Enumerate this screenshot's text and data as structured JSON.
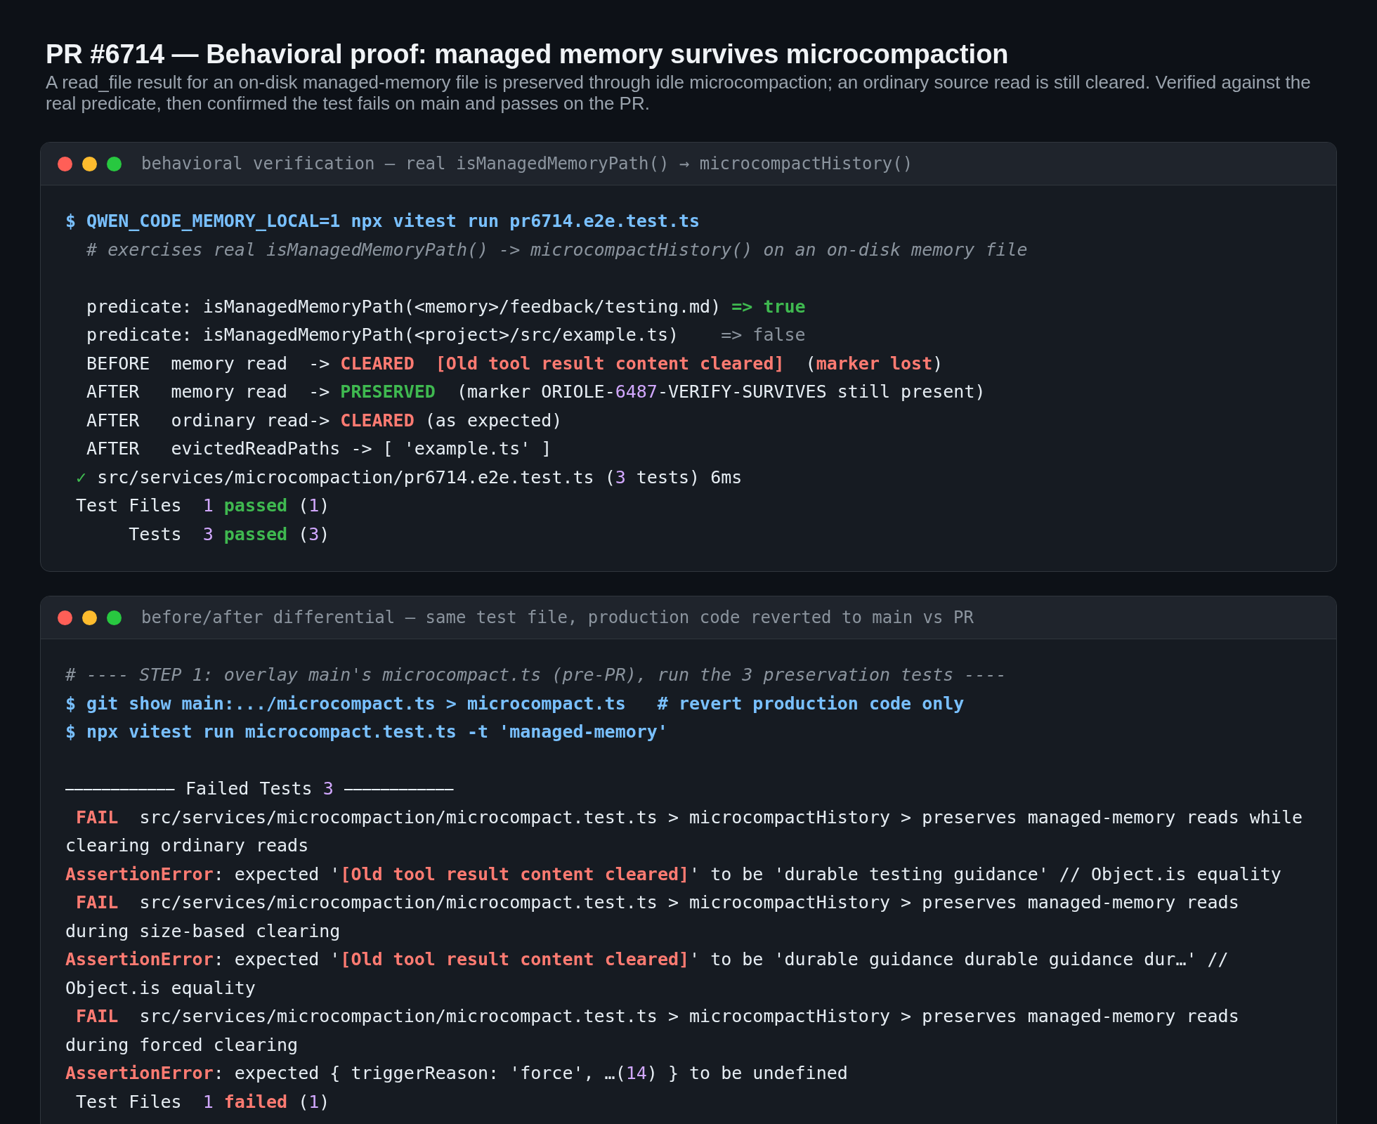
{
  "title": "PR #6714 — Behavioral proof: managed memory survives microcompaction",
  "subtitle": "A read_file result for an on-disk managed-memory file is preserved through idle microcompaction; an ordinary source read is still cleared. Verified against the real predicate, then confirmed the test fails on main and passes on the PR.",
  "terminals": [
    {
      "title": "behavioral verification — real isManagedMemoryPath() → microcompactHistory()",
      "lines": [
        {
          "kind": "text",
          "parts": [
            {
              "kind": "command",
              "text": "$ QWEN_CODE_MEMORY_LOCAL=1 npx vitest run pr6714.e2e.test.ts"
            }
          ]
        },
        {
          "kind": "text",
          "parts": [
            {
              "kind": "comment",
              "text": "  # exercises real isManagedMemoryPath() -> microcompactHistory() on an on-disk memory file"
            }
          ]
        },
        {
          "kind": "blank"
        },
        {
          "kind": "text",
          "parts": [
            {
              "kind": "output",
              "text": "  predicate: isManagedMemoryPath(<memory>/feedback/testing.md) "
            },
            {
              "kind": "success",
              "text": "=> true"
            }
          ]
        },
        {
          "kind": "text",
          "parts": [
            {
              "kind": "output",
              "text": "  predicate: isManagedMemoryPath(<project>/src/example.ts)"
            },
            {
              "kind": "muted",
              "text": "    => false"
            }
          ]
        },
        {
          "kind": "text",
          "parts": [
            {
              "kind": "output",
              "text": "  BEFORE  memory read  -> "
            },
            {
              "kind": "error",
              "text": "CLEARED  [Old tool result content cleared]"
            },
            {
              "kind": "output",
              "text": "  ("
            },
            {
              "kind": "error",
              "text": "marker lost"
            },
            {
              "kind": "output",
              "text": ")"
            }
          ]
        },
        {
          "kind": "text",
          "parts": [
            {
              "kind": "output",
              "text": "  AFTER   memory read  -> "
            },
            {
              "kind": "success",
              "text": "PRESERVED"
            },
            {
              "kind": "output",
              "text": "  (marker ORIOLE-"
            },
            {
              "kind": "number",
              "text": "6487"
            },
            {
              "kind": "output",
              "text": "-VERIFY-SURVIVES still present)"
            }
          ]
        },
        {
          "kind": "text",
          "parts": [
            {
              "kind": "output",
              "text": "  AFTER   ordinary read-> "
            },
            {
              "kind": "error",
              "text": "CLEARED"
            },
            {
              "kind": "output",
              "text": " (as expected)"
            }
          ]
        },
        {
          "kind": "text",
          "parts": [
            {
              "kind": "output",
              "text": "  AFTER   evictedReadPaths -> [ 'example.ts' ]"
            }
          ]
        },
        {
          "kind": "text",
          "parts": [
            {
              "kind": "check",
              "text": " ✓"
            },
            {
              "kind": "output",
              "text": " src/services/microcompaction/pr6714.e2e.test.ts ("
            },
            {
              "kind": "number",
              "text": "3"
            },
            {
              "kind": "output",
              "text": " tests) 6ms"
            }
          ]
        },
        {
          "kind": "text",
          "parts": [
            {
              "kind": "output",
              "text": " Test Files  "
            },
            {
              "kind": "number",
              "text": "1"
            },
            {
              "kind": "success",
              "text": " passed"
            },
            {
              "kind": "output",
              "text": " ("
            },
            {
              "kind": "number",
              "text": "1"
            },
            {
              "kind": "output",
              "text": ")"
            }
          ]
        },
        {
          "kind": "text",
          "parts": [
            {
              "kind": "output",
              "text": "      Tests  "
            },
            {
              "kind": "number",
              "text": "3"
            },
            {
              "kind": "success",
              "text": " passed"
            },
            {
              "kind": "output",
              "text": " ("
            },
            {
              "kind": "number",
              "text": "3"
            },
            {
              "kind": "output",
              "text": ")"
            }
          ]
        }
      ]
    },
    {
      "title": "before/after differential — same test file, production code reverted to main vs PR",
      "lines": [
        {
          "kind": "text",
          "parts": [
            {
              "kind": "comment",
              "text": "# ---- STEP 1: overlay main's microcompact.ts (pre-PR), run the 3 preservation tests ----"
            }
          ]
        },
        {
          "kind": "text",
          "parts": [
            {
              "kind": "command",
              "text": "$ git show main:.../microcompact.ts > microcompact.ts   # revert production code only"
            }
          ]
        },
        {
          "kind": "text",
          "parts": [
            {
              "kind": "command",
              "text": "$ npx vitest run microcompact.test.ts -t 'managed-memory'"
            }
          ]
        },
        {
          "kind": "blank"
        },
        {
          "kind": "text",
          "parts": [
            {
              "kind": "output",
              "text": "⎯⎯⎯⎯⎯⎯⎯⎯⎯⎯⎯⎯ Failed Tests "
            },
            {
              "kind": "number",
              "text": "3"
            },
            {
              "kind": "output",
              "text": " ⎯⎯⎯⎯⎯⎯⎯⎯⎯⎯⎯⎯"
            }
          ]
        },
        {
          "kind": "text",
          "parts": [
            {
              "kind": "error",
              "text": " FAIL"
            },
            {
              "kind": "output",
              "text": "  src/services/microcompaction/microcompact.test.ts > microcompactHistory > preserves managed-memory reads while clearing ordinary reads"
            }
          ]
        },
        {
          "kind": "text",
          "parts": [
            {
              "kind": "error",
              "text": "AssertionError"
            },
            {
              "kind": "output",
              "text": ": expected '"
            },
            {
              "kind": "error",
              "text": "[Old tool result content cleared]"
            },
            {
              "kind": "output",
              "text": "' to be 'durable testing guidance' // Object.is equality"
            }
          ]
        },
        {
          "kind": "text",
          "parts": [
            {
              "kind": "error",
              "text": " FAIL"
            },
            {
              "kind": "output",
              "text": "  src/services/microcompaction/microcompact.test.ts > microcompactHistory > preserves managed-memory reads during size-based clearing"
            }
          ]
        },
        {
          "kind": "text",
          "parts": [
            {
              "kind": "error",
              "text": "AssertionError"
            },
            {
              "kind": "output",
              "text": ": expected '"
            },
            {
              "kind": "error",
              "text": "[Old tool result content cleared]"
            },
            {
              "kind": "output",
              "text": "' to be 'durable guidance durable guidance dur…' // Object.is equality"
            }
          ]
        },
        {
          "kind": "text",
          "parts": [
            {
              "kind": "error",
              "text": " FAIL"
            },
            {
              "kind": "output",
              "text": "  src/services/microcompaction/microcompact.test.ts > microcompactHistory > preserves managed-memory reads during forced clearing"
            }
          ]
        },
        {
          "kind": "text",
          "parts": [
            {
              "kind": "error",
              "text": "AssertionError"
            },
            {
              "kind": "output",
              "text": ": expected { triggerReason: 'force', …("
            },
            {
              "kind": "number",
              "text": "14"
            },
            {
              "kind": "output",
              "text": ") } to be undefined"
            }
          ]
        },
        {
          "kind": "text",
          "parts": [
            {
              "kind": "output",
              "text": " Test Files  "
            },
            {
              "kind": "number",
              "text": "1"
            },
            {
              "kind": "error",
              "text": " failed"
            },
            {
              "kind": "output",
              "text": " ("
            },
            {
              "kind": "number",
              "text": "1"
            },
            {
              "kind": "output",
              "text": ")"
            }
          ]
        }
      ]
    }
  ]
}
